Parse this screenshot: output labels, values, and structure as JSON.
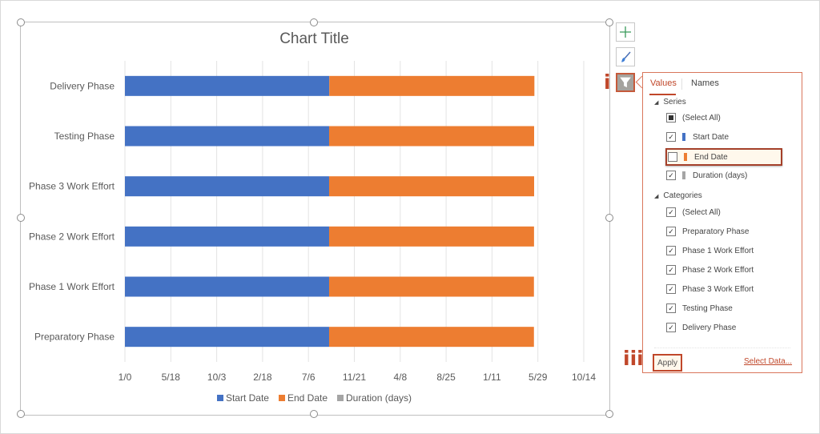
{
  "chart_data": {
    "type": "bar",
    "orientation": "horizontal",
    "stacked": true,
    "title": "Chart Title",
    "xlabel": "",
    "ylabel": "",
    "categories": [
      "Preparatory Phase",
      "Phase 1 Work Effort",
      "Phase 2 Work Effort",
      "Phase 3 Work Effort",
      "Testing Phase",
      "Delivery Phase"
    ],
    "series": [
      {
        "name": "Start Date",
        "color": "#4472C4",
        "values": [
          2225,
          2225,
          2225,
          2225,
          2225,
          2227
        ]
      },
      {
        "name": "End Date",
        "color": "#ED7D31",
        "values": [
          2232,
          2232,
          2233,
          2234,
          2234,
          2235
        ]
      },
      {
        "name": "Duration (days)",
        "color": "#A5A5A5",
        "values": [
          0,
          0,
          0,
          0,
          0,
          0
        ]
      }
    ],
    "xlim": [
      0,
      5000
    ],
    "xtick_values": [
      0,
      500,
      1000,
      1500,
      2000,
      2500,
      3000,
      3500,
      4000,
      4500,
      5000
    ],
    "xtick_labels": [
      "1/0",
      "5/18",
      "10/3",
      "2/18",
      "7/6",
      "11/21",
      "4/8",
      "8/25",
      "1/11",
      "5/29",
      "10/14"
    ],
    "grid": true,
    "legend_position": "bottom"
  },
  "side_buttons": {
    "add": "chart-elements",
    "style": "chart-styles",
    "filter": "chart-filters"
  },
  "markers": {
    "i": "i",
    "ii": "ii",
    "iii": "iii"
  },
  "filter_panel": {
    "tabs": [
      {
        "label": "Values"
      },
      {
        "label": "Names"
      }
    ],
    "series_heading": "Series",
    "series_items": [
      {
        "label": "(Select All)",
        "state": "partial"
      },
      {
        "label": "Start Date",
        "state": "checked",
        "color": "#4472C4"
      },
      {
        "label": "End Date",
        "state": "unchecked",
        "color": "#ED7D31"
      },
      {
        "label": "Duration (days)",
        "state": "checked",
        "color": "#A5A5A5"
      }
    ],
    "categories_heading": "Categories",
    "category_items": [
      {
        "label": "(Select All)",
        "state": "checked"
      },
      {
        "label": "Preparatory Phase",
        "state": "checked"
      },
      {
        "label": "Phase 1 Work Effort",
        "state": "checked"
      },
      {
        "label": "Phase 2 Work Effort",
        "state": "checked"
      },
      {
        "label": "Phase 3 Work Effort",
        "state": "checked"
      },
      {
        "label": "Testing Phase",
        "state": "checked"
      },
      {
        "label": "Delivery Phase",
        "state": "checked"
      }
    ],
    "apply_label": "Apply",
    "select_data_label": "Select Data..."
  }
}
